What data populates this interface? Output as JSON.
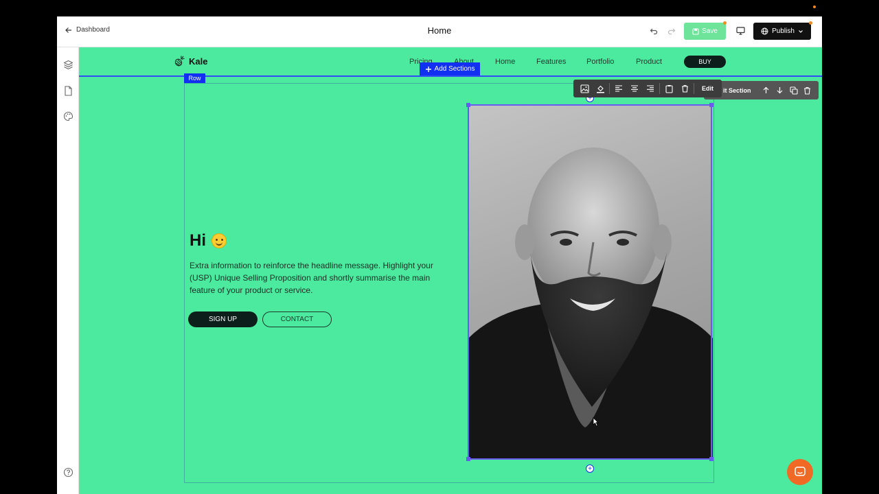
{
  "topbar": {
    "back_label": "Dashboard",
    "page_title": "Home",
    "save_label": "Save",
    "publish_label": "Publish"
  },
  "site": {
    "brand": "Kale",
    "nav": [
      "Pricing",
      "About",
      "Home",
      "Features",
      "Portfolio",
      "Product"
    ],
    "buy_label": "BUY"
  },
  "editor": {
    "add_sections_label": "Add Sections",
    "row_label": "Row",
    "image_toolbar_edit": "Edit",
    "section_toolbar_label": "it Section"
  },
  "hero": {
    "title": "Hi",
    "body": "Extra information to reinforce the headline message. Highlight your (USP) Unique Selling Proposition and shortly summarise the main feature of your product or service.",
    "signup_label": "SIGN UP",
    "contact_label": "CONTACT"
  },
  "colors": {
    "canvas_bg": "#4cea9f",
    "accent_blue": "#1230f2",
    "save_green": "#6ee39a",
    "chat_orange": "#f06a25"
  }
}
